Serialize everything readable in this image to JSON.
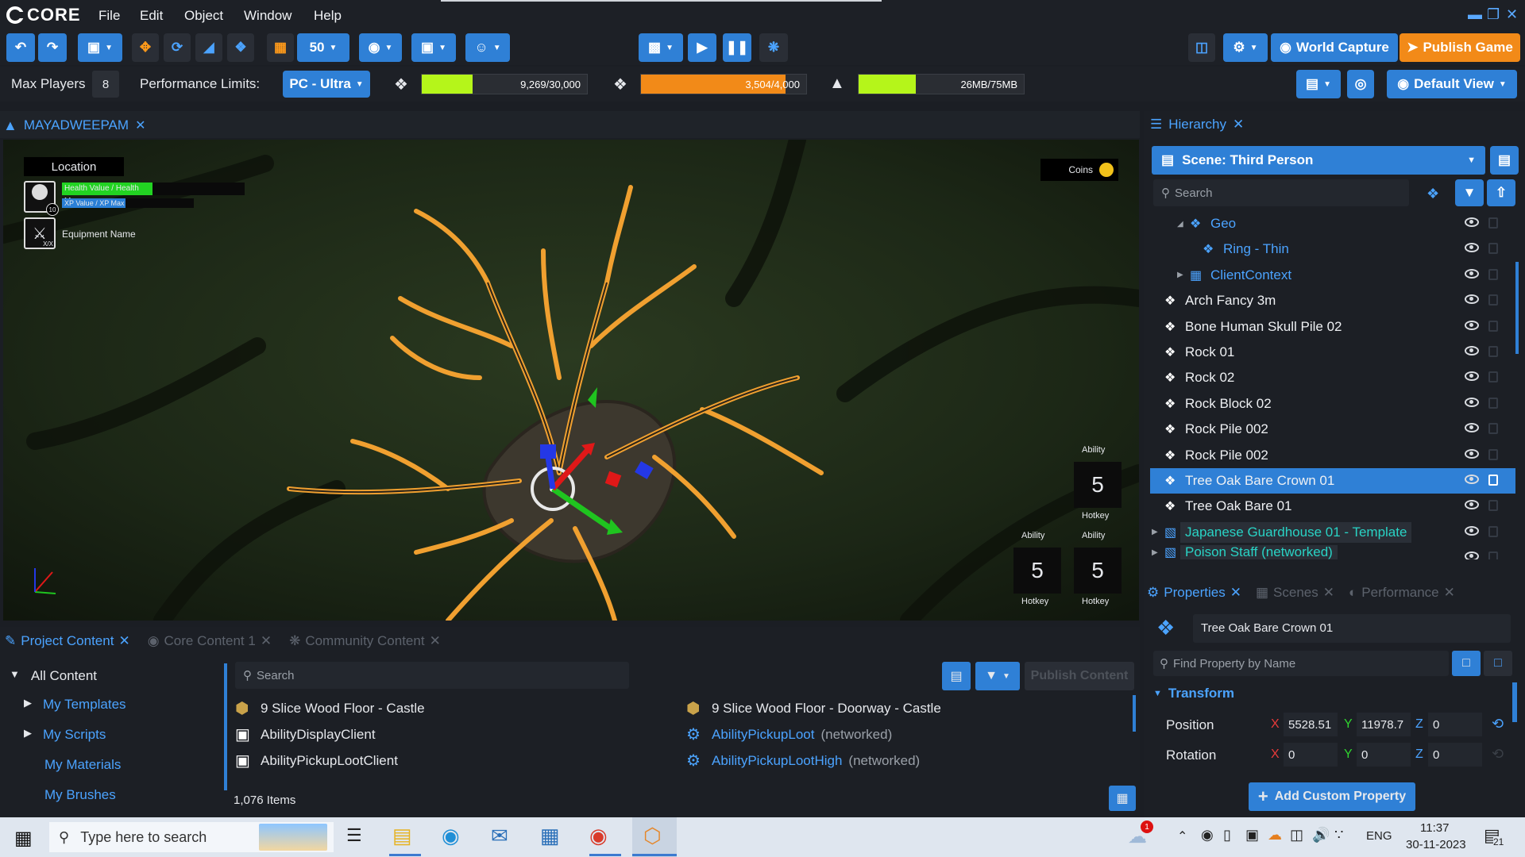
{
  "app": {
    "logo": "CORE",
    "menu": [
      "File",
      "Edit",
      "Object",
      "Window",
      "Help"
    ],
    "window_controls": [
      "minimize-icon",
      "restore-icon",
      "close-icon"
    ]
  },
  "toolbar": {
    "grid_size": "50",
    "world_capture_label": "World Capture",
    "publish_label": "Publish Game"
  },
  "perf": {
    "max_players_label": "Max Players",
    "max_players_value": "8",
    "limits_label": "Performance Limits:",
    "limits_value": "PC - Ultra",
    "bars": [
      {
        "icon": "objects-icon",
        "text": "9,269/30,000",
        "fraction": 0.309,
        "color": "#b5f51a"
      },
      {
        "icon": "networked-icon",
        "text": "3,504/4,000",
        "fraction": 0.876,
        "color": "#f28a18"
      },
      {
        "icon": "memory-icon",
        "text": "26MB/75MB",
        "fraction": 0.347,
        "color": "#b5f51a"
      }
    ],
    "default_view_label": "Default View"
  },
  "viewport": {
    "tab_title": "MAYADWEEPAM",
    "hud": {
      "location": "Location",
      "health": "Health Value / Health Max",
      "xp": "XP Value / XP Max",
      "level": "10",
      "equipment": "Equipment Name",
      "equip_count": "X/X",
      "coins": "Coins",
      "abilities": [
        {
          "label": "Ability",
          "value": "5",
          "hotkey": "Hotkey"
        },
        {
          "label": "Ability",
          "value": "5",
          "hotkey": "Hotkey"
        },
        {
          "label": "Ability",
          "value": "5",
          "hotkey": "Hotkey"
        }
      ]
    }
  },
  "hierarchy": {
    "tab_title": "Hierarchy",
    "scene_label": "Scene: Third Person",
    "search_placeholder": "Search",
    "rows": [
      {
        "label": "Geo",
        "style": "folder",
        "indent": 2
      },
      {
        "label": "Ring - Thin",
        "style": "child",
        "indent": 3
      },
      {
        "label": "ClientContext",
        "style": "context",
        "indent": 2
      },
      {
        "label": "Arch Fancy 3m",
        "style": "normal",
        "indent": 0
      },
      {
        "label": "Bone Human Skull Pile 02",
        "style": "normal",
        "indent": 0
      },
      {
        "label": "Rock 01",
        "style": "normal",
        "indent": 0
      },
      {
        "label": "Rock 02",
        "style": "normal",
        "indent": 0
      },
      {
        "label": "Rock Block 02",
        "style": "normal",
        "indent": 0
      },
      {
        "label": "Rock Pile 002",
        "style": "normal",
        "indent": 0
      },
      {
        "label": "Rock Pile 002",
        "style": "normal",
        "indent": 0
      },
      {
        "label": "Tree Oak Bare Crown 01",
        "style": "selected",
        "indent": 0
      },
      {
        "label": "Tree Oak Bare 01",
        "style": "normal",
        "indent": 0
      },
      {
        "label": "Japanese Guardhouse 01 - Template",
        "style": "template",
        "indent": 0
      },
      {
        "label": "Poison Staff (networked)",
        "style": "template",
        "indent": 0
      }
    ]
  },
  "properties": {
    "tabs": [
      "Properties",
      "Scenes",
      "Performance"
    ],
    "object_name": "Tree Oak Bare Crown 01",
    "find_placeholder": "Find Property by Name",
    "section": "Transform",
    "position_label": "Position",
    "rotation_label": "Rotation",
    "position": {
      "x": "5528.51",
      "y": "11978.7",
      "z": "0"
    },
    "rotation": {
      "x": "0",
      "y": "0",
      "z": "0"
    },
    "axis_x": "X",
    "axis_y": "Y",
    "axis_z": "Z",
    "add_custom_label": "Add Custom Property"
  },
  "content": {
    "tabs": [
      "Project Content",
      "Core Content 1",
      "Community Content"
    ],
    "tree": [
      "All Content",
      "My Templates",
      "My Scripts",
      "My Materials",
      "My Brushes"
    ],
    "search_placeholder": "Search",
    "publish_label": "Publish Content",
    "items_left": [
      {
        "name": "9 Slice Wood Floor - Castle",
        "suffix": "",
        "kind": "template"
      },
      {
        "name": "AbilityDisplayClient",
        "suffix": "",
        "kind": "script"
      },
      {
        "name": "AbilityPickupLootClient",
        "suffix": "",
        "kind": "script"
      }
    ],
    "items_right": [
      {
        "name": "9 Slice Wood Floor - Doorway - Castle",
        "suffix": "",
        "kind": "template"
      },
      {
        "name": "AbilityPickupLoot",
        "suffix": "(networked)",
        "kind": "networked"
      },
      {
        "name": "AbilityPickupLootHigh",
        "suffix": "(networked)",
        "kind": "networked"
      }
    ],
    "count": "1,076 Items"
  },
  "taskbar": {
    "search_placeholder": "Type here to search",
    "language": "ENG",
    "time": "11:37",
    "date": "30-11-2023",
    "notification_count": "21",
    "weather_badge": "1"
  }
}
